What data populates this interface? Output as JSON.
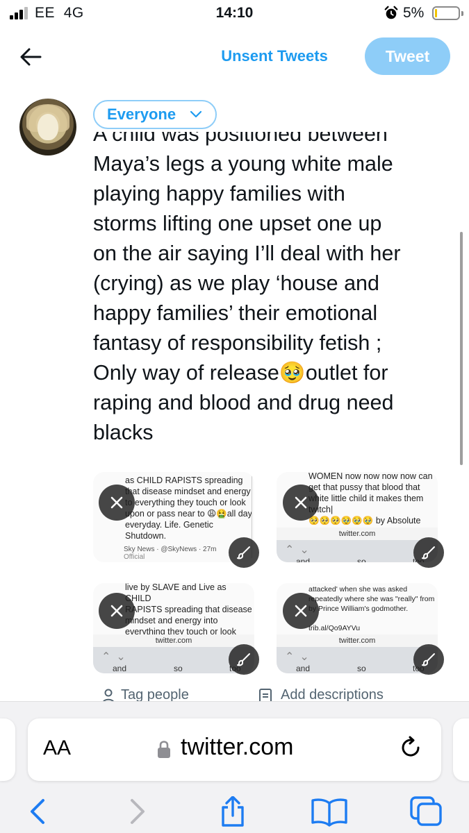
{
  "status_bar": {
    "carrier": "EE",
    "network": "4G",
    "time": "14:10",
    "battery_percent": "5%",
    "battery_level": 0.05,
    "battery_color": "#f2c300",
    "signal_bars": 3
  },
  "header": {
    "back_icon": "arrow-left-icon",
    "drafts_label": "Unsent Tweets",
    "tweet_label": "Tweet"
  },
  "composer": {
    "audience_label": "Everyone",
    "text_lines": [
      "A child was positioned between",
      "Maya’s legs a young white male",
      "playing happy families with",
      "storms lifting one upset one up",
      "on the air saying I’ll deal with her",
      "(crying) as we play ‘house and",
      "happy families’ their emotional",
      "fantasy of responsibility fetish ;",
      "Only way of release🥹outlet for",
      "raping and blood and drug need",
      "blacks"
    ]
  },
  "media": [
    {
      "text": "as CHILD RAPISTS spreading\nthat disease mindset and energy\nto everything they touch or look\nupon or pass near to 😩🤮all day\neveryday. Life. Genetic\nShutdown.",
      "card": "Sky News · @SkyNews · 27m",
      "card_sub": "Official"
    },
    {
      "text": "WOMEN now now now now can\nget that pussy that blood that\nwhite little child it makes them\ntwitch|\n🥺🥺🥺🥹🥹🥹 by Absolute",
      "url": "twitter.com",
      "suggestions": [
        "and",
        "so",
        "too"
      ]
    },
    {
      "text": "live by SLAVE and Live as CHILD\nRAPISTS spreading that disease\nmindset and energy into\neverything they touch or look\nupon or pass near to 😩🤮all day",
      "url": "twitter.com",
      "suggestions": [
        "and",
        "so",
        "too"
      ]
    },
    {
      "text": "attacked' when she was asked\nrepeatedly where she was \"really\" from\nby Prince William's godmother.\n\ntrib.al/Qo9AYVu",
      "url": "twitter.com",
      "suggestions": [
        "and",
        "so",
        "too"
      ]
    }
  ],
  "media_actions": {
    "tag_people": "Tag people",
    "add_descriptions": "Add descriptions"
  },
  "browser": {
    "aa_label": "AA",
    "domain": "twitter.com",
    "toolbar_icons": [
      "back-icon",
      "forward-icon",
      "share-icon",
      "bookmarks-icon",
      "tabs-icon"
    ]
  },
  "colors": {
    "accent": "#1d9bf0",
    "tweet_button_disabled": "#8ecdf8",
    "secondary_text": "#536471"
  }
}
